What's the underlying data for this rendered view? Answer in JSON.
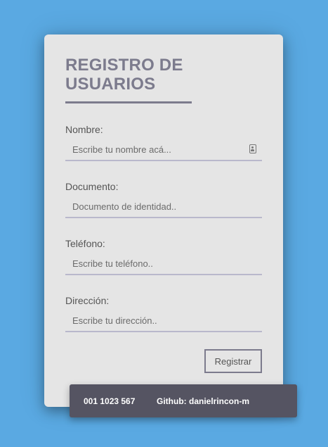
{
  "form": {
    "title": "REGISTRO DE USUARIOS",
    "fields": [
      {
        "label": "Nombre:",
        "placeholder": "Escribe tu nombre acá...",
        "icon": "contact-card-icon"
      },
      {
        "label": "Documento:",
        "placeholder": "Documento de identidad.."
      },
      {
        "label": "Teléfono:",
        "placeholder": "Escribe tu teléfono.."
      },
      {
        "label": "Dirección:",
        "placeholder": "Escribe tu dirección.."
      }
    ],
    "submit_label": "Registrar"
  },
  "footer": {
    "document_number": "001 1023 567",
    "github": "Github: danielrincon-m"
  },
  "colors": {
    "background": "#5aa9e2",
    "card": "#e5e5e5",
    "accent": "#7c7b8d",
    "footer": "#555462"
  }
}
